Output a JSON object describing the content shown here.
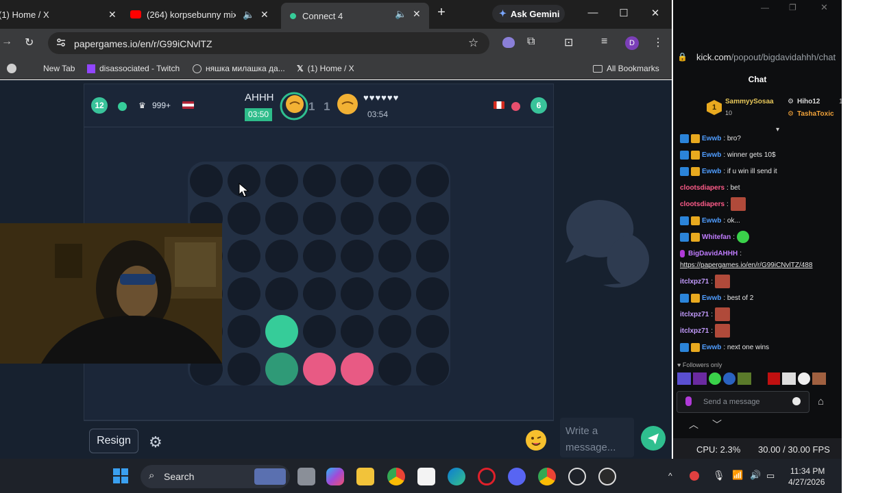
{
  "browser": {
    "tabs": [
      {
        "label": "(1) Home / X",
        "icon": "x-logo-icon"
      },
      {
        "label": "(264) korpsebunny mix",
        "icon": "youtube-icon"
      },
      {
        "label": "Connect 4",
        "icon": "papergames-icon"
      }
    ],
    "ask_gemini": "Ask Gemini",
    "url": "papergames.io/en/r/G99iCNvlTZ",
    "profile_initial": "D",
    "bookmarks": [
      {
        "label": "New Tab"
      },
      {
        "label": "disassociated - Twitch"
      },
      {
        "label": "няшка милашка да..."
      },
      {
        "label": "(1) Home / X"
      }
    ],
    "all_bookmarks": "All Bookmarks"
  },
  "game": {
    "left_player": {
      "level": "12",
      "trophies": "999+",
      "flag": "us-flag-icon"
    },
    "center": {
      "name": "AHHH",
      "timer_left": "03:50",
      "score": "1 1",
      "hearts": "♥♥♥♥♥♥",
      "timer_right": "03:54"
    },
    "right_player": {
      "level": "6",
      "flag": "ca-flag-icon"
    },
    "board": {
      "cols": 7,
      "rows": 6,
      "pieces": [
        {
          "row": 5,
          "col": 2,
          "color": "green"
        },
        {
          "row": 6,
          "col": 2,
          "color": "dark-green"
        },
        {
          "row": 6,
          "col": 3,
          "color": "pink"
        },
        {
          "row": 6,
          "col": 4,
          "color": "pink"
        }
      ]
    },
    "resign_label": "Resign",
    "message_placeholder": "Write a message..."
  },
  "chat": {
    "url_host": "kick.com",
    "url_path": "/popout/bigdavidahhh/chat",
    "title": "Chat",
    "gifters": [
      {
        "name": "SammyySosaa",
        "count": "10"
      },
      {
        "name": "Hiho12",
        "count": "1"
      },
      {
        "name": "TashaToxic"
      }
    ],
    "messages": [
      {
        "user": "Ewwb",
        "text": ": bro?",
        "color": "#4f9dff",
        "badges": true
      },
      {
        "user": "Ewwb",
        "text": ": winner gets 10$",
        "color": "#4f9dff",
        "badges": true
      },
      {
        "user": "Ewwb",
        "text": ": if u win ill send it",
        "color": "#4f9dff",
        "badges": true
      },
      {
        "user": "clootsdiapers",
        "text": ": bet",
        "color": "#ff5c8a",
        "badges": false
      },
      {
        "user": "clootsdiapers",
        "text": ":",
        "color": "#ff5c8a",
        "badges": false,
        "emote": true
      },
      {
        "user": "Ewwb",
        "text": ": ok...",
        "color": "#4f9dff",
        "badges": true
      },
      {
        "user": "Whitefan",
        "text": ":",
        "color": "#c07cff",
        "badges": true,
        "emote": true
      },
      {
        "user": "BigDavidAHHH",
        "text": ":",
        "color": "#c07cff",
        "badges": false,
        "mic": true
      },
      {
        "user": "",
        "text": "https://papergames.io/en/r/G99iCNvlTZ/488",
        "color": "#e8e8e8",
        "badges": false,
        "link": true
      },
      {
        "user": "itclxpz71",
        "text": ":",
        "color": "#c49cff",
        "badges": false,
        "emote": true
      },
      {
        "user": "Ewwb",
        "text": ": best of 2",
        "color": "#4f9dff",
        "badges": true
      },
      {
        "user": "itclxpz71",
        "text": ":",
        "color": "#c49cff",
        "badges": false,
        "emote": true
      },
      {
        "user": "itclxpz71",
        "text": ":",
        "color": "#c49cff",
        "badges": false,
        "emote": true
      },
      {
        "user": "Ewwb",
        "text": ": next one wins",
        "color": "#4f9dff",
        "badges": true
      }
    ],
    "followers_only": "Followers only",
    "input_placeholder": "Send a message"
  },
  "stats": {
    "cpu": "CPU: 2.3%",
    "fps": "30.00 / 30.00 FPS"
  },
  "taskbar": {
    "search_label": "Search",
    "time": "11:34 PM",
    "date": "4/27/2026"
  }
}
